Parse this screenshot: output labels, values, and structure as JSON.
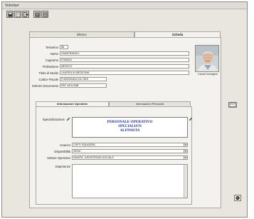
{
  "window": {
    "title": "Volontari"
  },
  "toolbar": {
    "icons": [
      "save-icon",
      "document-icon",
      "exit-icon",
      "list-icon",
      "grid-icon"
    ]
  },
  "tabs": [
    {
      "label": "Elenco"
    },
    {
      "label": "Scheda"
    }
  ],
  "form": {
    "tesserino": {
      "label": "Tesserino",
      "value": "88"
    },
    "nome": {
      "label": "Nome",
      "value": "GIANFRANCO"
    },
    "cognome": {
      "label": "Cognome",
      "value": "FUMAGI"
    },
    "professione": {
      "label": "Professione",
      "value": "MEDICO"
    },
    "titolo_studio": {
      "label": "Titolo di Studio",
      "value": "LAUREA IN MEDICINA"
    },
    "codice_fiscale": {
      "label": "Codice Fiscale",
      "value": "FGMGNN61L01L781K"
    },
    "estremi_documento": {
      "label": "Estremi Documento",
      "value": "PAT. AE1234B"
    }
  },
  "photo": {
    "caption": "Cancel Immagine"
  },
  "subtabs": [
    {
      "label": "Informazioni Operative"
    },
    {
      "label": "Informazioni Personali"
    }
  ],
  "operative": {
    "specializzazione": {
      "label": "Specializzazione",
      "lines": [
        "PERSONALE OPERATIVO",
        "SPECIALISTI",
        "ALPINISTA"
      ]
    },
    "incarico": {
      "label": "Incarico",
      "value": "CAPO SQUADRA"
    },
    "disponibilita": {
      "label": "Disponibilità",
      "value": "SERA"
    },
    "settore": {
      "label": "Settore Operativo",
      "value": "SANITA', ASSISTENZA SOCIALE"
    },
    "esperienze": {
      "label": "Esperienze",
      "value": ""
    }
  },
  "colors": {
    "specialization_text": "#1a2f8a",
    "window_bg": "#e9e5df"
  }
}
